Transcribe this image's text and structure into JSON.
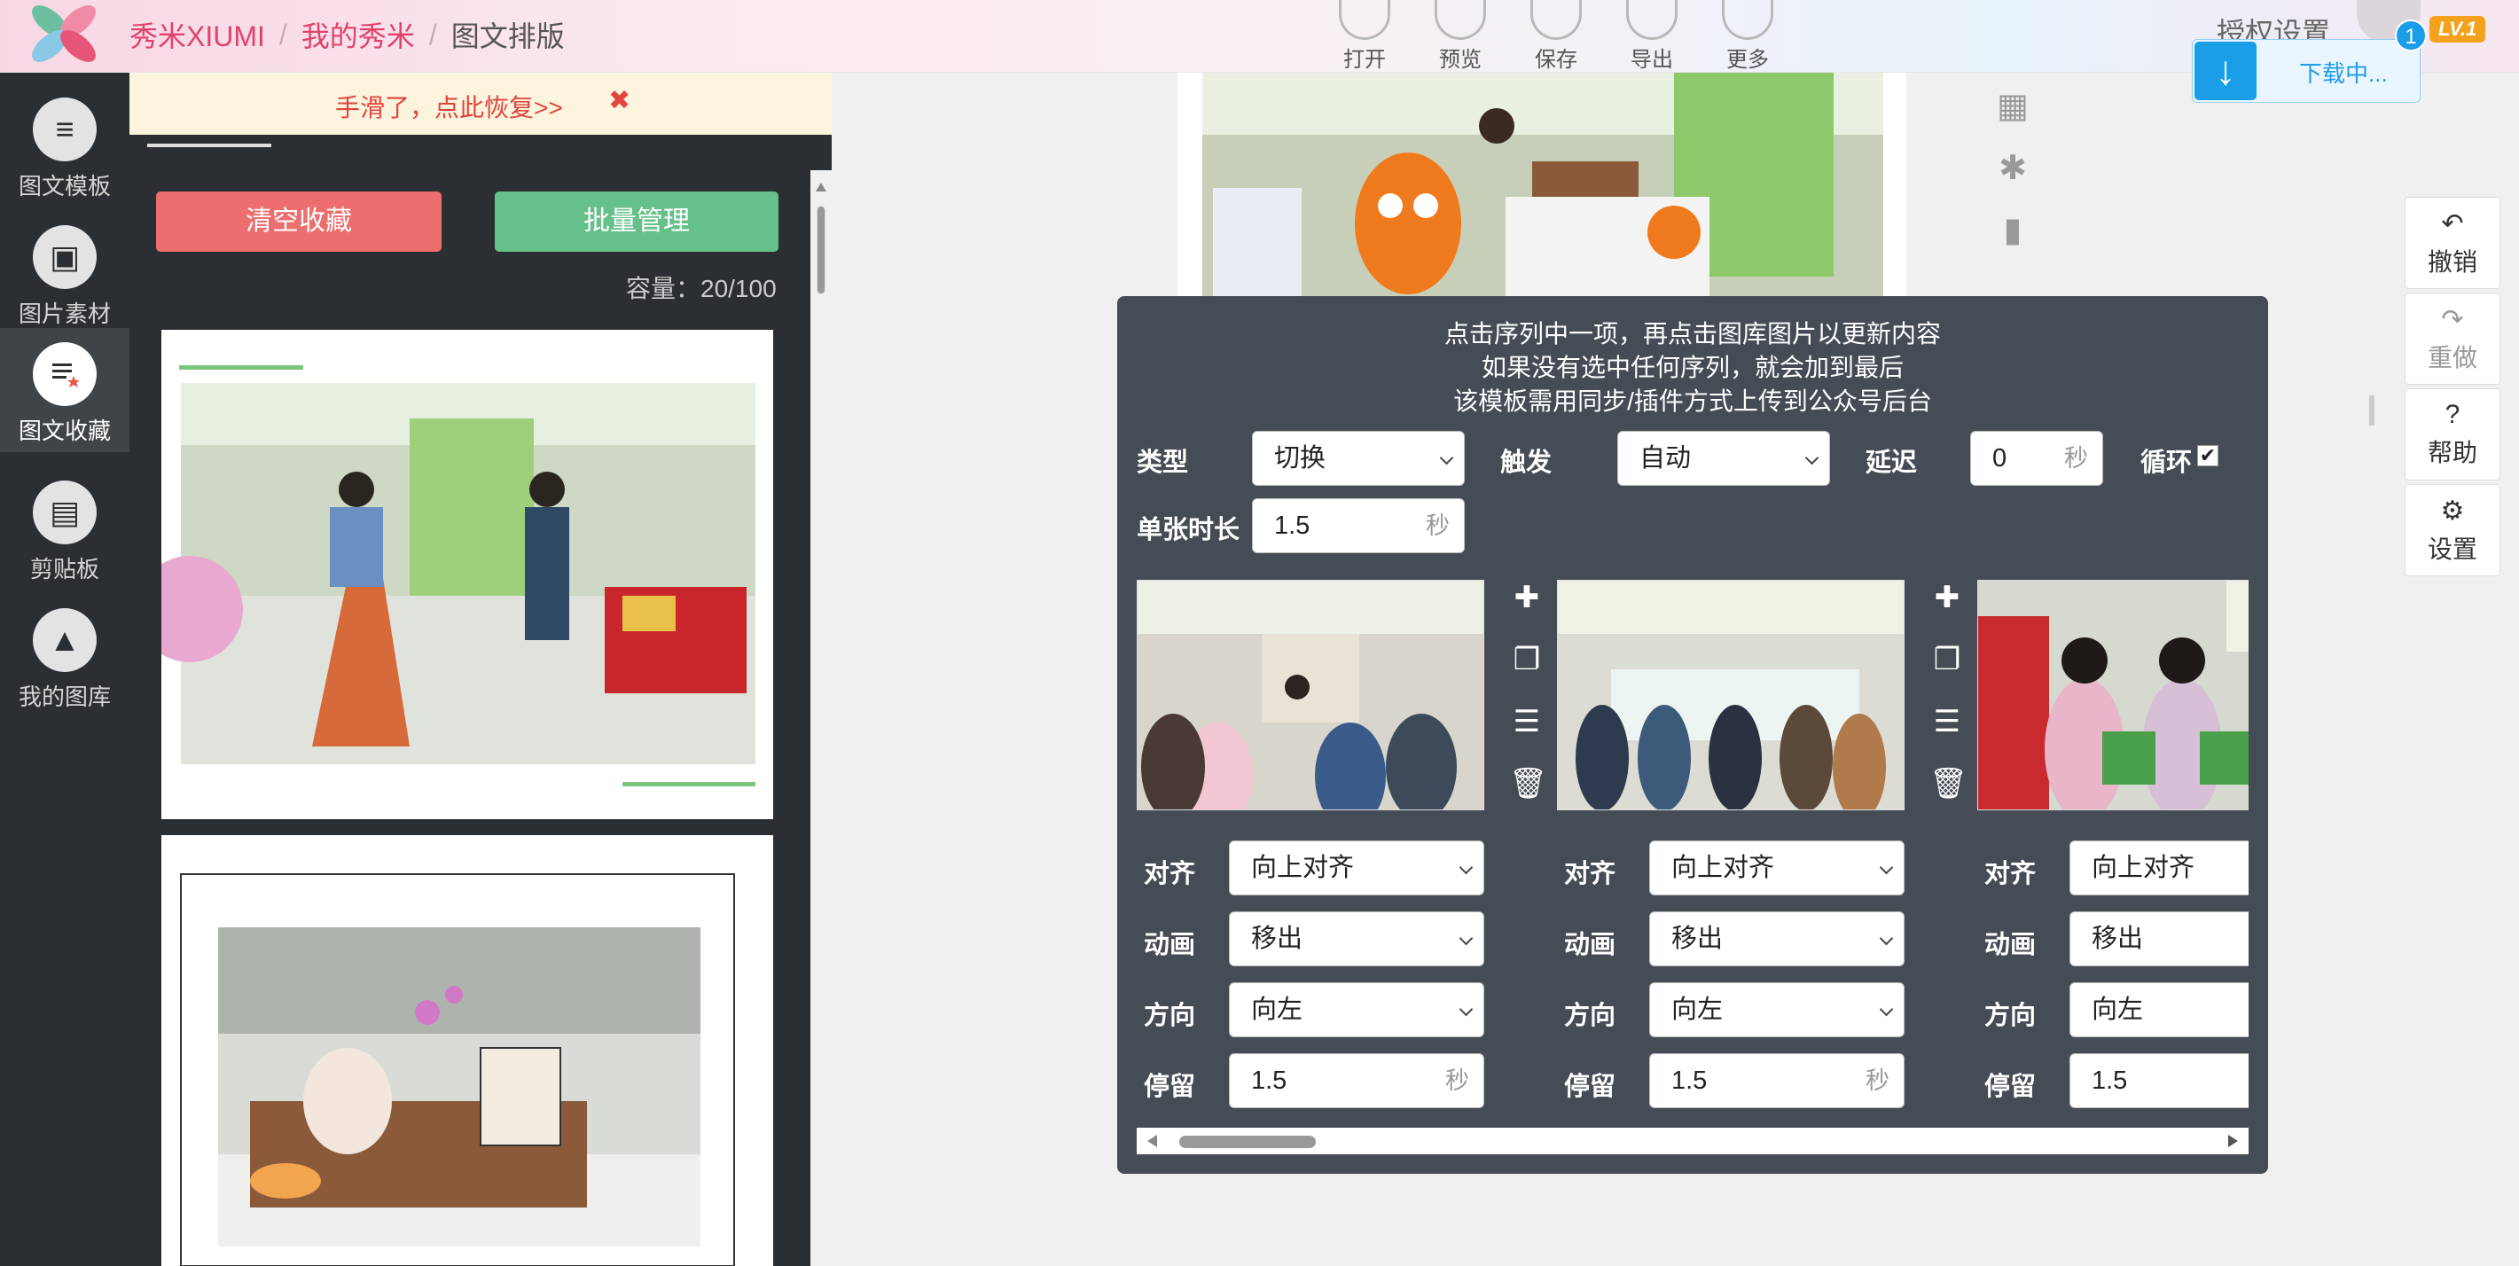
{
  "breadcrumb": [
    "秀米XIUMI",
    "我的秀米",
    "图文排版"
  ],
  "toolbar": [
    "打开",
    "预览",
    "保存",
    "导出",
    "更多"
  ],
  "auth_label": "授权设置",
  "level": "LV.1",
  "download": {
    "text": "下载中...",
    "badge": "1"
  },
  "nav": [
    "图文模板",
    "图片素材",
    "图文收藏",
    "剪贴板",
    "我的图库"
  ],
  "nav_active": 2,
  "restore_bar": {
    "text": "手滑了，点此恢复>>",
    "close": "✖"
  },
  "fav": {
    "clear_btn": "清空收藏",
    "manage_btn": "批量管理",
    "capacity": "容量：20/100"
  },
  "right_actions": [
    {
      "icon": "undo-icon",
      "glyph": "↶",
      "label": "撤销"
    },
    {
      "icon": "redo-icon",
      "glyph": "↷",
      "label": "重做"
    },
    {
      "icon": "help-icon",
      "glyph": "?",
      "label": "帮助"
    },
    {
      "icon": "gear-icon",
      "glyph": "⚙",
      "label": "设置"
    }
  ],
  "dialog": {
    "hints": [
      "点击序列中一项，再点击图库图片以更新内容",
      "如果没有选中任何序列，就会加到最后",
      "该模板需用同步/插件方式上传到公众号后台"
    ],
    "type_label": "类型",
    "type_value": "切换",
    "trigger_label": "触发",
    "trigger_value": "自动",
    "delay_label": "延迟",
    "delay_value": "0",
    "delay_unit": "秒",
    "loop_label": "循环",
    "loop_checked": "✔",
    "duration_label": "单张时长",
    "duration_value": "1.5",
    "duration_unit": "秒",
    "frame_labels": {
      "align": "对齐",
      "anim": "动画",
      "dir": "方向",
      "stay": "停留"
    },
    "frames": [
      {
        "align": "向上对齐",
        "anim": "移出",
        "dir": "向左",
        "stay": "1.5",
        "unit": "秒"
      },
      {
        "align": "向上对齐",
        "anim": "移出",
        "dir": "向左",
        "stay": "1.5",
        "unit": "秒"
      },
      {
        "align": "向上对齐",
        "anim": "移出",
        "dir": "向左",
        "stay": "1.5",
        "unit": ""
      }
    ]
  },
  "colors": {
    "brand_red": "#e2426a",
    "clear_red": "#ec6e6e",
    "manage_green": "#66c08a",
    "dialog_bg": "#464c55",
    "nav_bg": "#2b2f33",
    "download_blue": "#1a9ee8"
  }
}
